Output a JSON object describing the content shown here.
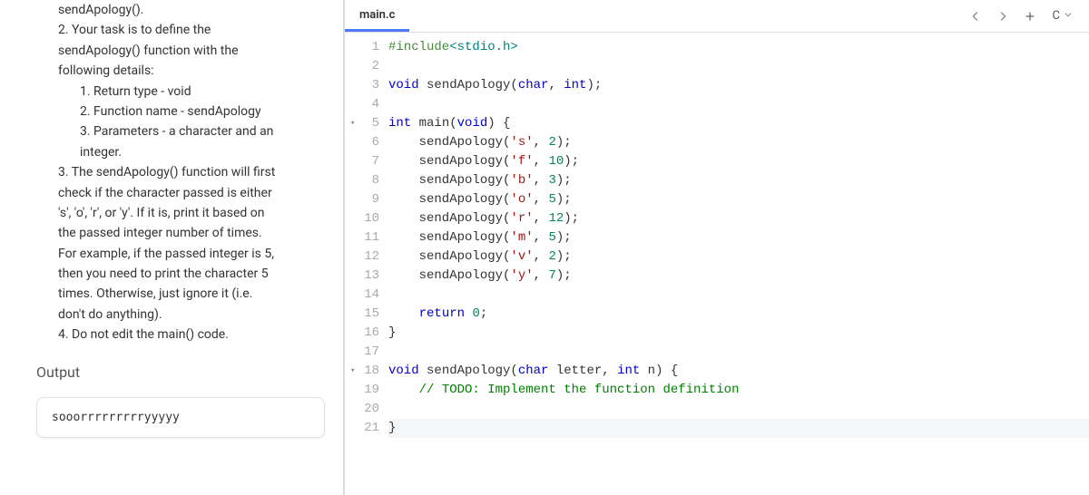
{
  "instructions": {
    "lines": [
      {
        "indent": "indent-3",
        "text": "sendApology()."
      },
      {
        "indent": "indent-1",
        "text": "2. Your task is to define the"
      },
      {
        "indent": "indent-3",
        "text": "sendApology() function with the"
      },
      {
        "indent": "indent-3",
        "text": "following details:"
      },
      {
        "indent": "indent-2",
        "text": "1. Return type - void"
      },
      {
        "indent": "indent-2",
        "text": "2. Function name - sendApology"
      },
      {
        "indent": "indent-2",
        "text": "3. Parameters - a character and an"
      },
      {
        "indent": "indent-2",
        "text": "    integer."
      },
      {
        "indent": "indent-1",
        "text": "3. The sendApology() function will first"
      },
      {
        "indent": "indent-3",
        "text": "check if the character passed is either"
      },
      {
        "indent": "indent-3",
        "text": "'s', 'o', 'r', or 'y'. If it is, print it based on"
      },
      {
        "indent": "indent-3",
        "text": "the passed integer number of times."
      },
      {
        "indent": "indent-3",
        "text": "For example, if the passed integer is 5,"
      },
      {
        "indent": "indent-3",
        "text": "then you need to print the character 5"
      },
      {
        "indent": "indent-3",
        "text": "times. Otherwise, just ignore it (i.e."
      },
      {
        "indent": "indent-3",
        "text": "don't do anything)."
      },
      {
        "indent": "indent-1",
        "text": "4. Do not edit the main() code."
      }
    ]
  },
  "output": {
    "title": "Output",
    "text": "sooorrrrrrrrryyyyy"
  },
  "editor": {
    "tab": "main.c",
    "language": "C",
    "lines": [
      {
        "n": 1,
        "fold": false,
        "tokens": [
          {
            "c": "tk-pre",
            "t": "#include"
          },
          {
            "c": "tk-ang",
            "t": "<stdio.h>"
          }
        ]
      },
      {
        "n": 2,
        "fold": false,
        "tokens": []
      },
      {
        "n": 3,
        "fold": false,
        "tokens": [
          {
            "c": "tk-kw",
            "t": "void"
          },
          {
            "c": "",
            "t": " sendApology("
          },
          {
            "c": "tk-kw",
            "t": "char"
          },
          {
            "c": "",
            "t": ", "
          },
          {
            "c": "tk-kw",
            "t": "int"
          },
          {
            "c": "",
            "t": ");"
          }
        ]
      },
      {
        "n": 4,
        "fold": false,
        "tokens": []
      },
      {
        "n": 5,
        "fold": true,
        "tokens": [
          {
            "c": "tk-kw",
            "t": "int"
          },
          {
            "c": "",
            "t": " main("
          },
          {
            "c": "tk-kw",
            "t": "void"
          },
          {
            "c": "",
            "t": ") {"
          }
        ]
      },
      {
        "n": 6,
        "fold": false,
        "tokens": [
          {
            "c": "",
            "t": "    sendApology("
          },
          {
            "c": "tk-str",
            "t": "'s'"
          },
          {
            "c": "",
            "t": ", "
          },
          {
            "c": "tk-num",
            "t": "2"
          },
          {
            "c": "",
            "t": ");"
          }
        ]
      },
      {
        "n": 7,
        "fold": false,
        "tokens": [
          {
            "c": "",
            "t": "    sendApology("
          },
          {
            "c": "tk-str",
            "t": "'f'"
          },
          {
            "c": "",
            "t": ", "
          },
          {
            "c": "tk-num",
            "t": "10"
          },
          {
            "c": "",
            "t": ");"
          }
        ]
      },
      {
        "n": 8,
        "fold": false,
        "tokens": [
          {
            "c": "",
            "t": "    sendApology("
          },
          {
            "c": "tk-str",
            "t": "'b'"
          },
          {
            "c": "",
            "t": ", "
          },
          {
            "c": "tk-num",
            "t": "3"
          },
          {
            "c": "",
            "t": ");"
          }
        ]
      },
      {
        "n": 9,
        "fold": false,
        "tokens": [
          {
            "c": "",
            "t": "    sendApology("
          },
          {
            "c": "tk-str",
            "t": "'o'"
          },
          {
            "c": "",
            "t": ", "
          },
          {
            "c": "tk-num",
            "t": "5"
          },
          {
            "c": "",
            "t": ");"
          }
        ]
      },
      {
        "n": 10,
        "fold": false,
        "tokens": [
          {
            "c": "",
            "t": "    sendApology("
          },
          {
            "c": "tk-str",
            "t": "'r'"
          },
          {
            "c": "",
            "t": ", "
          },
          {
            "c": "tk-num",
            "t": "12"
          },
          {
            "c": "",
            "t": ");"
          }
        ]
      },
      {
        "n": 11,
        "fold": false,
        "tokens": [
          {
            "c": "",
            "t": "    sendApology("
          },
          {
            "c": "tk-str",
            "t": "'m'"
          },
          {
            "c": "",
            "t": ", "
          },
          {
            "c": "tk-num",
            "t": "5"
          },
          {
            "c": "",
            "t": ");"
          }
        ]
      },
      {
        "n": 12,
        "fold": false,
        "tokens": [
          {
            "c": "",
            "t": "    sendApology("
          },
          {
            "c": "tk-str",
            "t": "'v'"
          },
          {
            "c": "",
            "t": ", "
          },
          {
            "c": "tk-num",
            "t": "2"
          },
          {
            "c": "",
            "t": ");"
          }
        ]
      },
      {
        "n": 13,
        "fold": false,
        "tokens": [
          {
            "c": "",
            "t": "    sendApology("
          },
          {
            "c": "tk-str",
            "t": "'y'"
          },
          {
            "c": "",
            "t": ", "
          },
          {
            "c": "tk-num",
            "t": "7"
          },
          {
            "c": "",
            "t": ");"
          }
        ]
      },
      {
        "n": 14,
        "fold": false,
        "tokens": []
      },
      {
        "n": 15,
        "fold": false,
        "tokens": [
          {
            "c": "",
            "t": "    "
          },
          {
            "c": "tk-kw",
            "t": "return"
          },
          {
            "c": "",
            "t": " "
          },
          {
            "c": "tk-num",
            "t": "0"
          },
          {
            "c": "",
            "t": ";"
          }
        ]
      },
      {
        "n": 16,
        "fold": false,
        "tokens": [
          {
            "c": "",
            "t": "}"
          }
        ]
      },
      {
        "n": 17,
        "fold": false,
        "tokens": []
      },
      {
        "n": 18,
        "fold": true,
        "tokens": [
          {
            "c": "tk-kw",
            "t": "void"
          },
          {
            "c": "",
            "t": " sendApology("
          },
          {
            "c": "tk-kw",
            "t": "char"
          },
          {
            "c": "",
            "t": " letter, "
          },
          {
            "c": "tk-kw",
            "t": "int"
          },
          {
            "c": "",
            "t": " n) {"
          }
        ]
      },
      {
        "n": 19,
        "fold": false,
        "tokens": [
          {
            "c": "",
            "t": "    "
          },
          {
            "c": "tk-cmt",
            "t": "// TODO: Implement the function definition"
          }
        ]
      },
      {
        "n": 20,
        "fold": false,
        "tokens": []
      },
      {
        "n": 21,
        "fold": false,
        "cursor": true,
        "tokens": [
          {
            "c": "",
            "t": "}"
          }
        ]
      }
    ]
  }
}
